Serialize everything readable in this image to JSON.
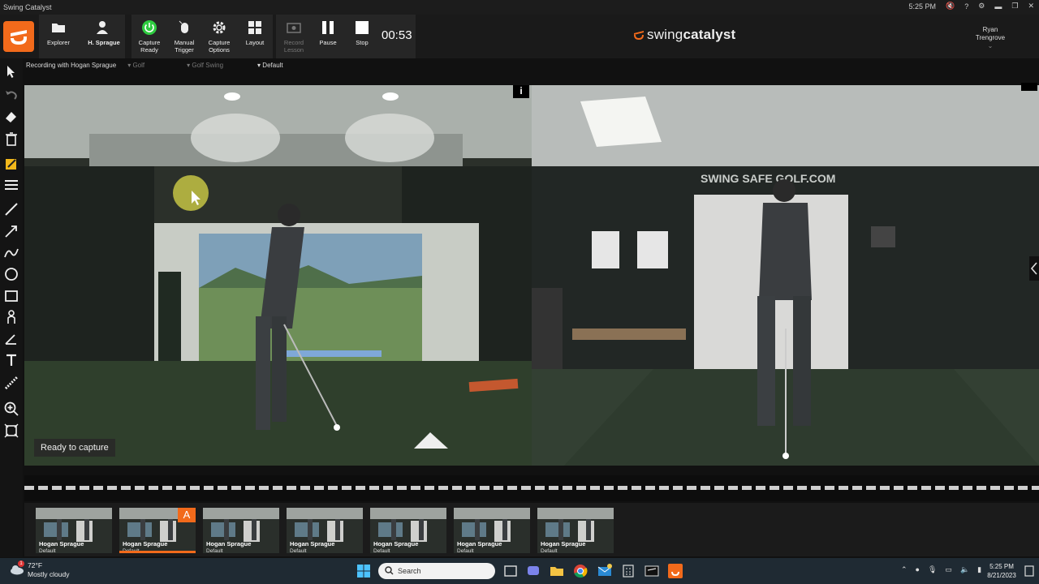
{
  "window": {
    "title": "Swing Catalyst",
    "system_time": "5:25 PM"
  },
  "toolbar": {
    "explorer": "Explorer",
    "player": "H. Sprague",
    "capture_ready": "Capture Ready",
    "manual_trigger": "Manual Trigger",
    "capture_options": "Capture Options",
    "layout": "Layout",
    "record_lesson": "Record Lesson",
    "pause": "Pause",
    "stop": "Stop",
    "timer": "00:53",
    "brand_prefix": "swing",
    "brand_suffix": "catalyst",
    "user_first": "Ryan",
    "user_last": "Trengrove",
    "accent": "#f26a1b"
  },
  "breadcrumb": {
    "recording": "Recording with  Hogan Sprague",
    "sport": "Golf",
    "activity": "Golf Swing",
    "preset": "Default"
  },
  "video": {
    "status": "Ready to capture",
    "wall_text": "SWING SAFE GOLF.COM"
  },
  "thumbnails": [
    {
      "name": "Hogan Sprague",
      "sub": "Default"
    },
    {
      "name": "Hogan Sprague",
      "sub": "Default",
      "badge": "A",
      "selected": true
    },
    {
      "name": "Hogan Sprague",
      "sub": "Default"
    },
    {
      "name": "Hogan Sprague",
      "sub": "Default"
    },
    {
      "name": "Hogan Sprague",
      "sub": "Default"
    },
    {
      "name": "Hogan Sprague",
      "sub": "Default"
    },
    {
      "name": "Hogan Sprague",
      "sub": "Default"
    }
  ],
  "taskbar": {
    "temp": "72°F",
    "weather": "Mostly cloudy",
    "weather_badge": "1",
    "search_placeholder": "Search",
    "time": "5:25 PM",
    "date": "8/21/2023"
  }
}
